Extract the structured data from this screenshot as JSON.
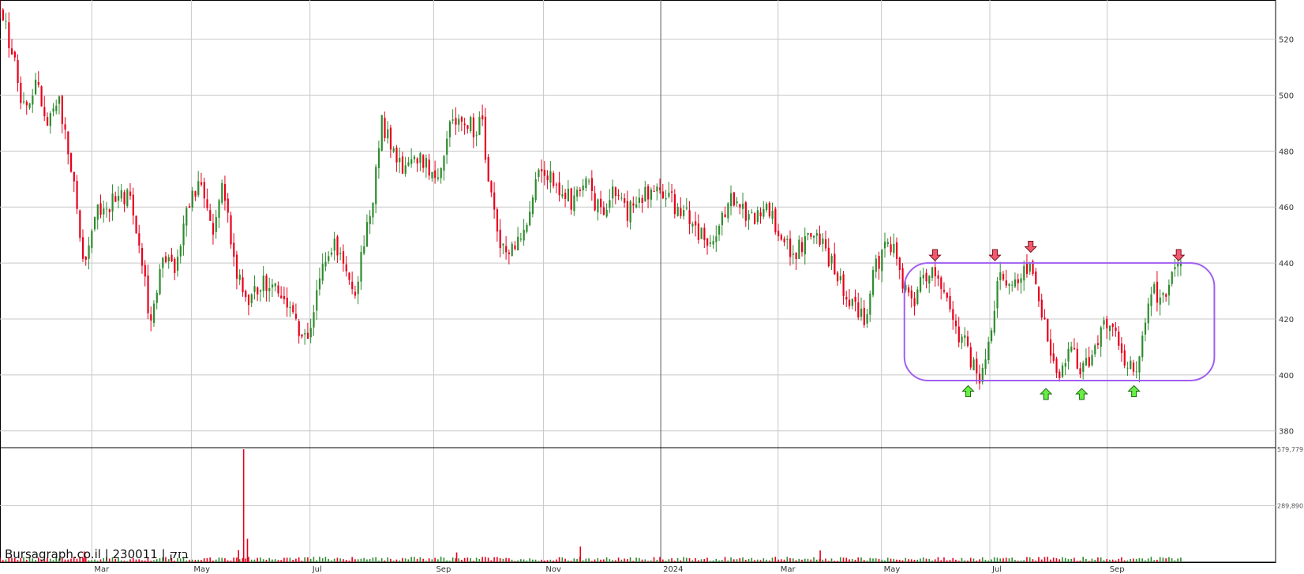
{
  "watermark": "Bursagraph.co.il | 230011 | בזק",
  "colors": {
    "up": "#2e8b2e",
    "down": "#e8001c",
    "channel": "#a05ef0",
    "grid": "#c8c8c8",
    "arrow_up": "#66ee44",
    "arrow_down": "#f25a6e"
  },
  "chart_data": {
    "type": "candlestick",
    "title": "",
    "xlabel": "",
    "ylabel": "",
    "ylim": [
      374,
      534
    ],
    "y_ticks": [
      380,
      400,
      420,
      440,
      460,
      480,
      500,
      520
    ],
    "x_ticks": [
      {
        "label": "Mar",
        "t": 0.072
      },
      {
        "label": "May",
        "t": 0.15
      },
      {
        "label": "Jul",
        "t": 0.243
      },
      {
        "label": "Sep",
        "t": 0.34
      },
      {
        "label": "Nov",
        "t": 0.426
      },
      {
        "label": "2024",
        "t": 0.518
      },
      {
        "label": "Mar",
        "t": 0.61
      },
      {
        "label": "May",
        "t": 0.691
      },
      {
        "label": "Jul",
        "t": 0.776
      },
      {
        "label": "Sep",
        "t": 0.868
      }
    ],
    "year_marker_t": 0.518,
    "price_keypoints": [
      [
        0.0,
        530
      ],
      [
        0.01,
        515
      ],
      [
        0.02,
        492
      ],
      [
        0.028,
        505
      ],
      [
        0.037,
        488
      ],
      [
        0.046,
        500
      ],
      [
        0.058,
        466
      ],
      [
        0.066,
        440
      ],
      [
        0.074,
        458
      ],
      [
        0.088,
        462
      ],
      [
        0.1,
        465
      ],
      [
        0.108,
        452
      ],
      [
        0.118,
        418
      ],
      [
        0.126,
        440
      ],
      [
        0.136,
        438
      ],
      [
        0.148,
        460
      ],
      [
        0.158,
        470
      ],
      [
        0.166,
        450
      ],
      [
        0.174,
        468
      ],
      [
        0.182,
        445
      ],
      [
        0.192,
        425
      ],
      [
        0.206,
        432
      ],
      [
        0.216,
        433
      ],
      [
        0.226,
        425
      ],
      [
        0.236,
        412
      ],
      [
        0.244,
        415
      ],
      [
        0.252,
        440
      ],
      [
        0.262,
        448
      ],
      [
        0.272,
        438
      ],
      [
        0.278,
        425
      ],
      [
        0.284,
        446
      ],
      [
        0.292,
        460
      ],
      [
        0.299,
        492
      ],
      [
        0.308,
        478
      ],
      [
        0.318,
        472
      ],
      [
        0.33,
        478
      ],
      [
        0.342,
        471
      ],
      [
        0.352,
        488
      ],
      [
        0.362,
        492
      ],
      [
        0.372,
        488
      ],
      [
        0.378,
        490
      ],
      [
        0.384,
        465
      ],
      [
        0.392,
        445
      ],
      [
        0.402,
        445
      ],
      [
        0.412,
        455
      ],
      [
        0.424,
        476
      ],
      [
        0.436,
        468
      ],
      [
        0.448,
        462
      ],
      [
        0.458,
        470
      ],
      [
        0.47,
        458
      ],
      [
        0.482,
        465
      ],
      [
        0.492,
        458
      ],
      [
        0.504,
        465
      ],
      [
        0.518,
        466
      ],
      [
        0.53,
        460
      ],
      [
        0.542,
        455
      ],
      [
        0.552,
        448
      ],
      [
        0.562,
        450
      ],
      [
        0.572,
        465
      ],
      [
        0.582,
        458
      ],
      [
        0.592,
        455
      ],
      [
        0.602,
        460
      ],
      [
        0.612,
        450
      ],
      [
        0.622,
        442
      ],
      [
        0.632,
        450
      ],
      [
        0.642,
        448
      ],
      [
        0.652,
        440
      ],
      [
        0.66,
        432
      ],
      [
        0.668,
        425
      ],
      [
        0.678,
        420
      ],
      [
        0.684,
        435
      ],
      [
        0.692,
        445
      ],
      [
        0.7,
        448
      ],
      [
        0.708,
        430
      ],
      [
        0.716,
        425
      ],
      [
        0.724,
        435
      ],
      [
        0.732,
        440
      ],
      [
        0.74,
        430
      ],
      [
        0.748,
        415
      ],
      [
        0.756,
        412
      ],
      [
        0.764,
        402
      ],
      [
        0.768,
        398
      ],
      [
        0.776,
        415
      ],
      [
        0.784,
        438
      ],
      [
        0.792,
        432
      ],
      [
        0.8,
        436
      ],
      [
        0.808,
        440
      ],
      [
        0.818,
        420
      ],
      [
        0.826,
        405
      ],
      [
        0.83,
        398
      ],
      [
        0.838,
        412
      ],
      [
        0.848,
        402
      ],
      [
        0.856,
        408
      ],
      [
        0.864,
        418
      ],
      [
        0.872,
        415
      ],
      [
        0.88,
        408
      ],
      [
        0.888,
        400
      ],
      [
        0.896,
        412
      ],
      [
        0.904,
        432
      ],
      [
        0.91,
        424
      ],
      [
        0.916,
        432
      ],
      [
        0.922,
        438
      ],
      [
        0.928,
        438
      ]
    ],
    "volume_max": 579779,
    "volume_ticks": [
      289890,
      579779
    ],
    "volume_tick_labels": [
      "289,890",
      "579,779"
    ],
    "volume_spikes": [
      {
        "t": 0.191,
        "v": 579779
      },
      {
        "t": 0.194,
        "v": 120000
      },
      {
        "t": 0.187,
        "v": 62000
      },
      {
        "t": 0.066,
        "v": 55000
      },
      {
        "t": 0.455,
        "v": 80000
      },
      {
        "t": 0.643,
        "v": 60000
      },
      {
        "t": 0.358,
        "v": 50000
      }
    ],
    "channel": {
      "t_start": 0.709,
      "t_end": 0.952,
      "upper": 440,
      "lower": 398
    },
    "arrows": [
      {
        "dir": "down",
        "t": 0.733,
        "price": 440
      },
      {
        "dir": "down",
        "t": 0.78,
        "price": 440
      },
      {
        "dir": "down",
        "t": 0.808,
        "price": 443
      },
      {
        "dir": "down",
        "t": 0.924,
        "price": 440
      },
      {
        "dir": "up",
        "t": 0.759,
        "price": 397
      },
      {
        "dir": "up",
        "t": 0.82,
        "price": 396
      },
      {
        "dir": "up",
        "t": 0.848,
        "price": 396
      },
      {
        "dir": "up",
        "t": 0.889,
        "price": 397
      }
    ]
  }
}
